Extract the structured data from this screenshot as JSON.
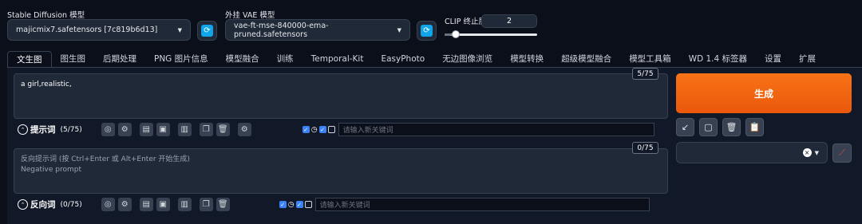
{
  "model": {
    "label": "Stable Diffusion 模型",
    "value": "majicmix7.safetensors [7c819b6d13]"
  },
  "vae": {
    "label": "外挂 VAE 模型",
    "value": "vae-ft-mse-840000-ema-pruned.safetensors"
  },
  "clip": {
    "label": "CLIP 终止层数",
    "value": "2",
    "slider_fraction": 0.08
  },
  "tabs": [
    "文生图",
    "图生图",
    "后期处理",
    "PNG 图片信息",
    "模型融合",
    "训练",
    "Temporal-Kit",
    "EasyPhoto",
    "无边图像浏览",
    "模型转换",
    "超级模型融合",
    "模型工具箱",
    "WD 1.4 标签器",
    "设置",
    "扩展"
  ],
  "active_tab": "文生图",
  "prompt": {
    "text": "a girl,realistic,",
    "counter": "5/75",
    "label": "提示词",
    "count": "(5/75)",
    "keyword_placeholder": "请输入新关键词"
  },
  "negative": {
    "placeholder_line1": "反向提示词 (按 Ctrl+Enter 或 Alt+Enter 开始生成)",
    "placeholder_line2": "Negative prompt",
    "counter": "0/75",
    "label": "反向词",
    "count": "(0/75)",
    "keyword_placeholder": "请输入新关键词"
  },
  "generate_label": "生成",
  "colors": {
    "accent": "#f97316",
    "refresh": "#0ea5e9",
    "checkbox": "#3b82f6"
  }
}
